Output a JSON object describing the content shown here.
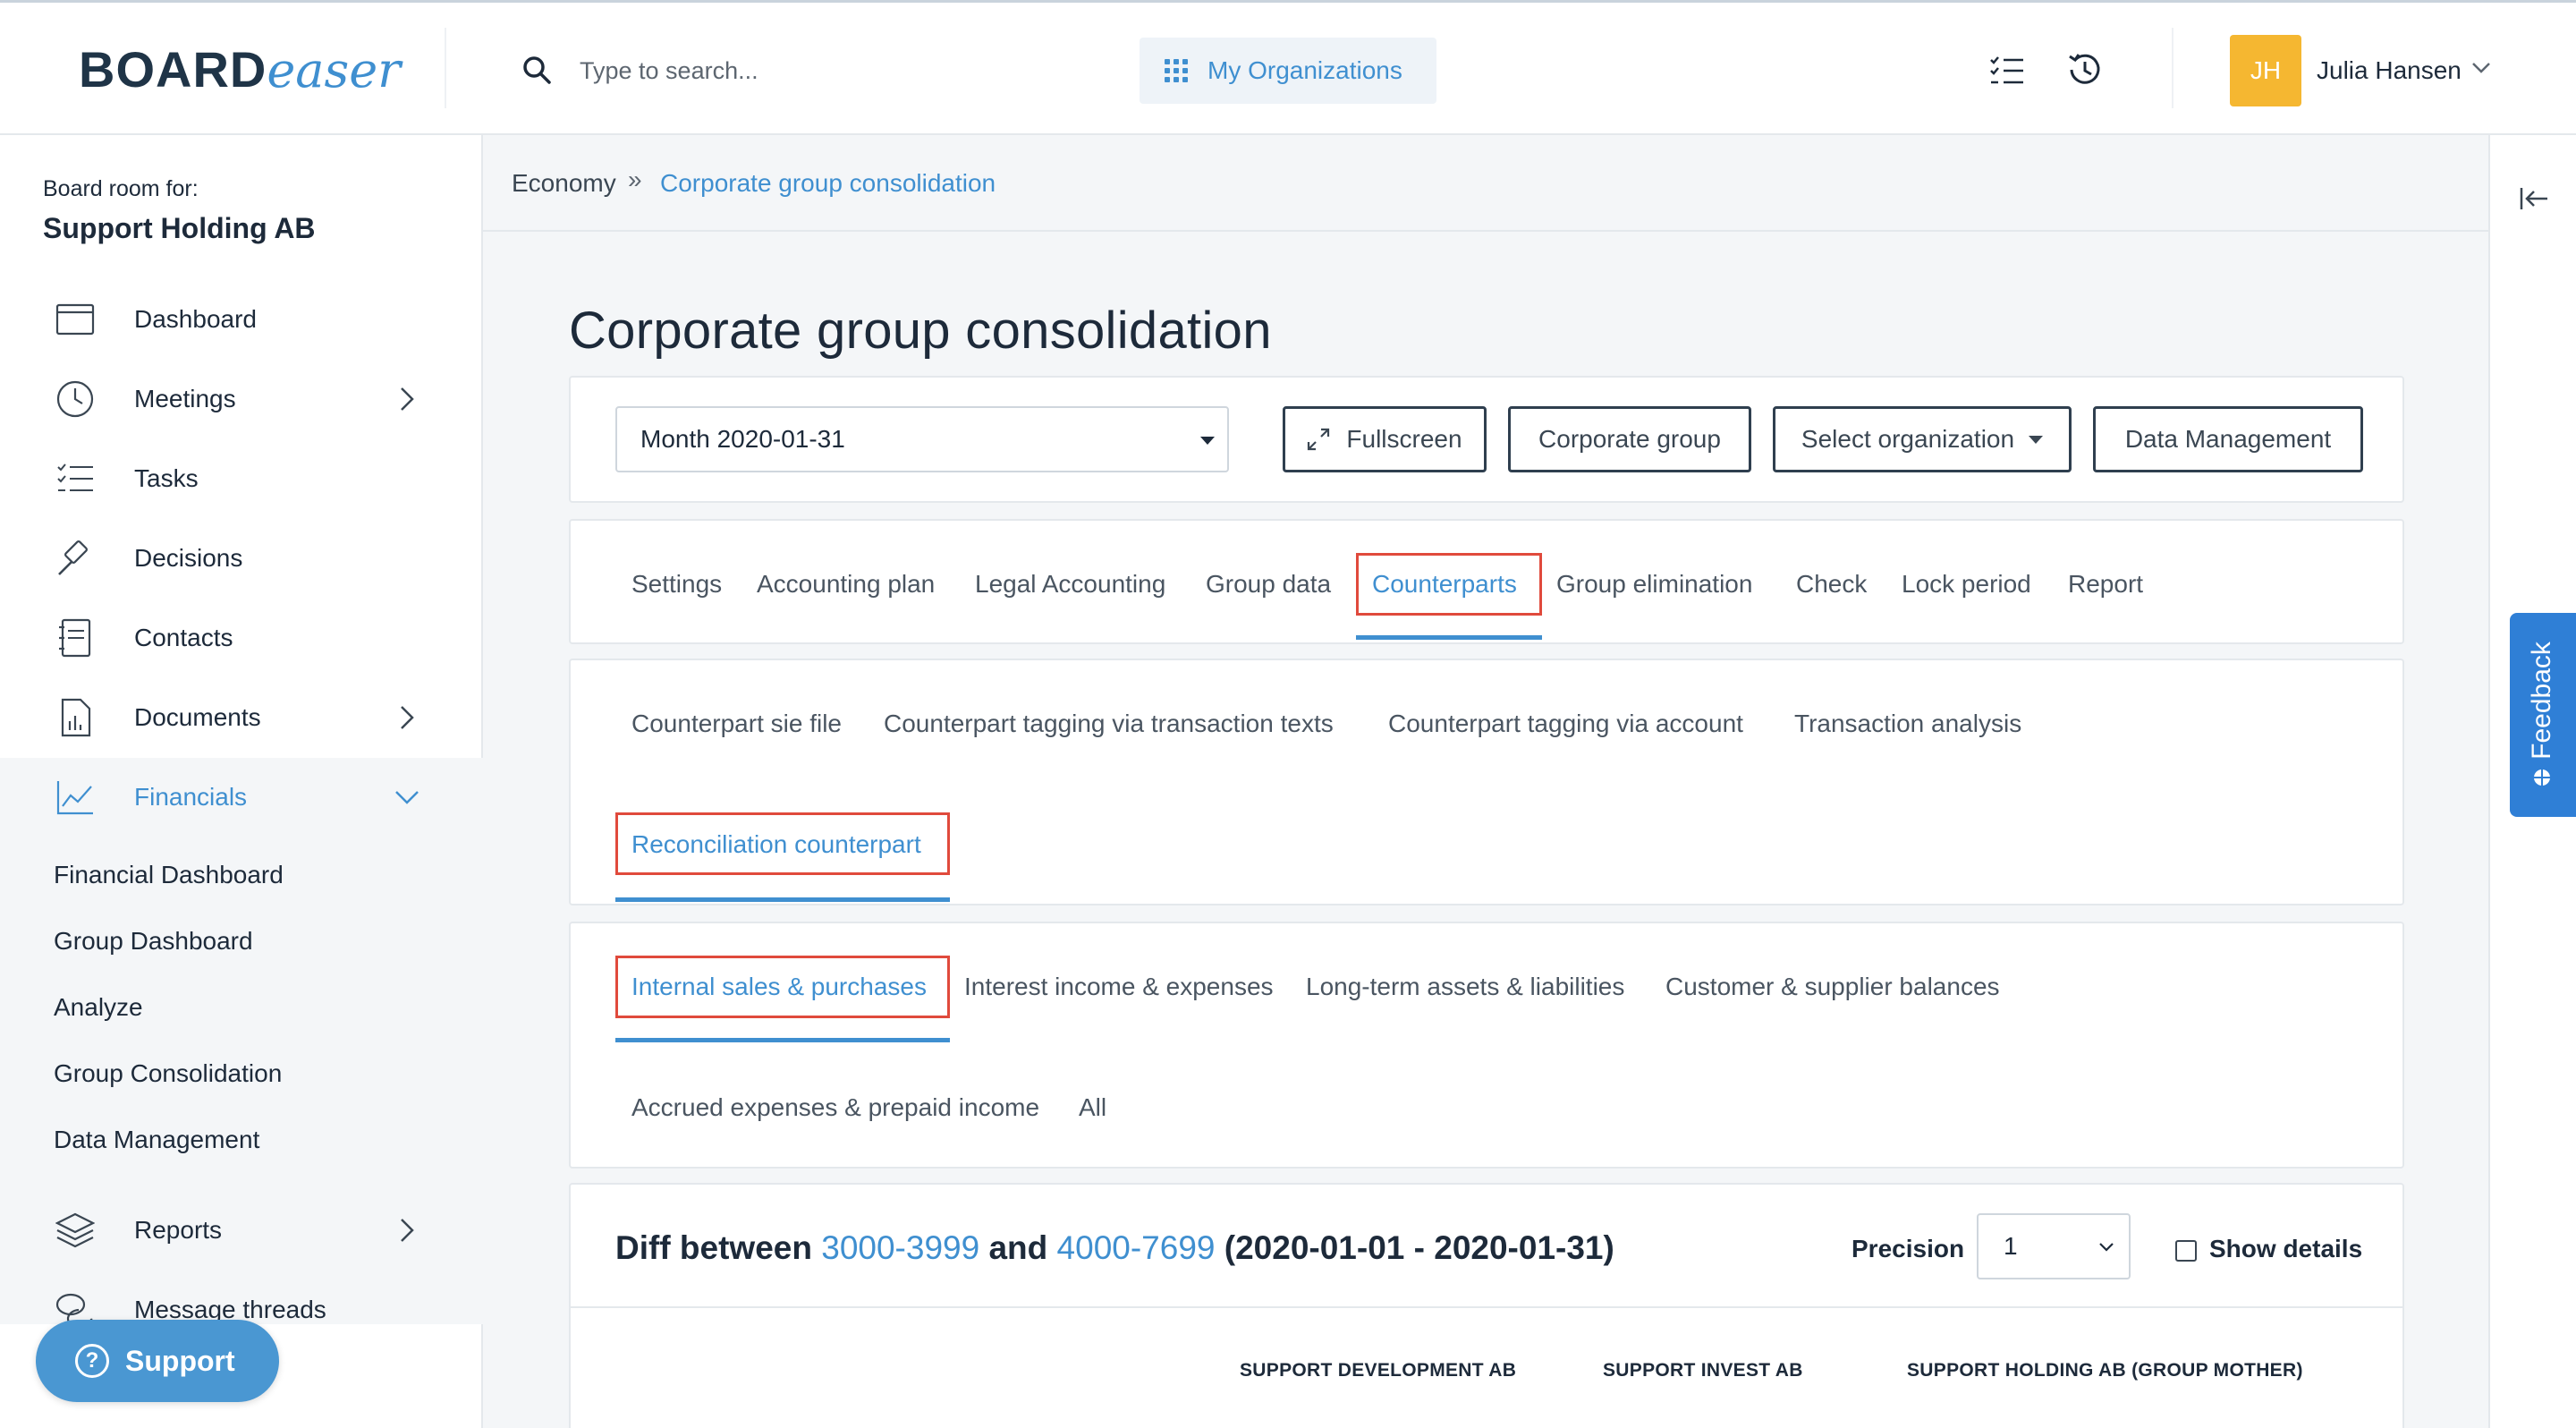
{
  "app": {
    "logo_main": "BOARD",
    "logo_accent": "easer"
  },
  "header": {
    "search_placeholder": "Type to search...",
    "orgs_label": "My Organizations",
    "user_initials": "JH",
    "user_name": "Julia Hansen",
    "colors": {
      "accent": "#3f8fd0",
      "avatar": "#f5b731"
    }
  },
  "sidebar": {
    "board_for": "Board room for:",
    "org_name": "Support Holding AB",
    "items": [
      {
        "label": "Dashboard",
        "icon": "calendar-window-icon"
      },
      {
        "label": "Meetings",
        "icon": "clock-icon"
      },
      {
        "label": "Tasks",
        "icon": "checklist-icon"
      },
      {
        "label": "Decisions",
        "icon": "gavel-icon"
      },
      {
        "label": "Contacts",
        "icon": "address-book-icon"
      },
      {
        "label": "Documents",
        "icon": "document-chart-icon"
      },
      {
        "label": "Financials",
        "icon": "line-chart-icon"
      },
      {
        "label": "Reports",
        "icon": "layers-icon"
      },
      {
        "label": "Message threads",
        "icon": "chat-bubbles-icon"
      }
    ],
    "financials_sub": [
      "Financial Dashboard",
      "Group Dashboard",
      "Analyze",
      "Group Consolidation",
      "Data Management"
    ],
    "support_label": "Support"
  },
  "feedback_label": "Feedback",
  "breadcrumb": {
    "parent": "Economy",
    "separator": "»",
    "current": "Corporate group consolidation"
  },
  "page": {
    "title": "Corporate group consolidation"
  },
  "toolbar": {
    "period_value": "Month 2020-01-31",
    "fullscreen_label": "Fullscreen",
    "corporate_group_label": "Corporate group",
    "select_org_label": "Select organization",
    "data_management_label": "Data Management"
  },
  "main_tabs": [
    "Settings",
    "Accounting plan",
    "Legal Accounting",
    "Group data",
    "Counterparts",
    "Group elimination",
    "Check",
    "Lock period",
    "Report"
  ],
  "counterpart_tabs": [
    "Counterpart sie file",
    "Counterpart tagging via transaction texts",
    "Counterpart tagging via account",
    "Transaction analysis",
    "Reconciliation counterpart"
  ],
  "reconciliation_tabs": [
    "Internal sales & purchases",
    "Interest income & expenses",
    "Long-term assets & liabilities",
    "Customer & supplier balances",
    "Accrued expenses & prepaid income",
    "All"
  ],
  "diff": {
    "prefix": "Diff between ",
    "range_a": "3000-3999",
    "middle": " and ",
    "range_b": "4000-7699",
    "period": " (2020-01-01 - 2020-01-31)",
    "precision_label": "Precision",
    "precision_value": "1",
    "show_details_label": "Show details",
    "columns": [
      "SUPPORT DEVELOPMENT AB",
      "SUPPORT INVEST AB",
      "SUPPORT HOLDING AB (GROUP MOTHER)"
    ]
  }
}
